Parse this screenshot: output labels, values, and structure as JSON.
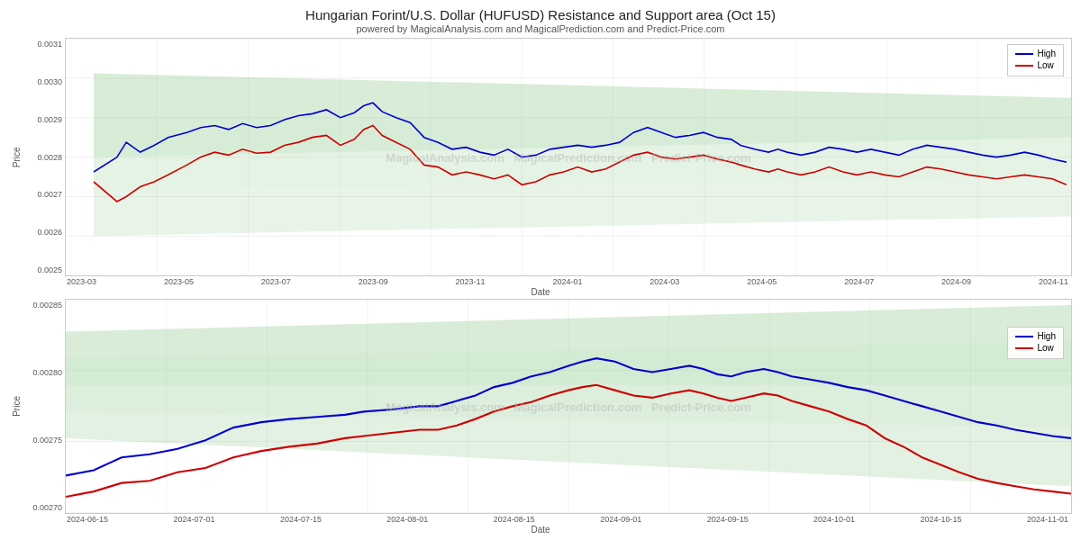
{
  "title": "Hungarian Forint/U.S. Dollar (HUFUSD) Resistance and Support area (Oct 15)",
  "subtitle": "powered by MagicalAnalysis.com and MagicalPrediction.com and Predict-Price.com",
  "chart1": {
    "y_label": "Price",
    "y_ticks": [
      "0.0031",
      "0.0030",
      "0.0029",
      "0.0028",
      "0.0027",
      "0.0026",
      "0.0025"
    ],
    "x_labels": [
      "2023-03",
      "2023-05",
      "2023-07",
      "2023-09",
      "2023-11",
      "2024-01",
      "2024-03",
      "2024-05",
      "2024-07",
      "2024-09",
      "2024-11"
    ],
    "x_axis_title": "Date",
    "legend": {
      "high_label": "High",
      "low_label": "Low",
      "high_color": "#0000cc",
      "low_color": "#cc0000"
    },
    "watermark": "MagicalAnalysis.com   MagicalPrediction.com   Predict-Price.com"
  },
  "chart2": {
    "y_label": "Price",
    "y_ticks": [
      "0.00285",
      "0.00280",
      "0.00275",
      "0.00270"
    ],
    "x_labels": [
      "2024-06-15",
      "2024-07-01",
      "2024-07-15",
      "2024-08-01",
      "2024-08-15",
      "2024-09-01",
      "2024-09-15",
      "2024-10-01",
      "2024-10-15",
      "2024-11-01"
    ],
    "x_axis_title": "Date",
    "legend": {
      "high_label": "High",
      "low_label": "Low",
      "high_color": "#0000cc",
      "low_color": "#cc0000"
    },
    "watermark": "MagicalAnalysis.com   MagicalPrediction.com   Predict-Price.com"
  }
}
